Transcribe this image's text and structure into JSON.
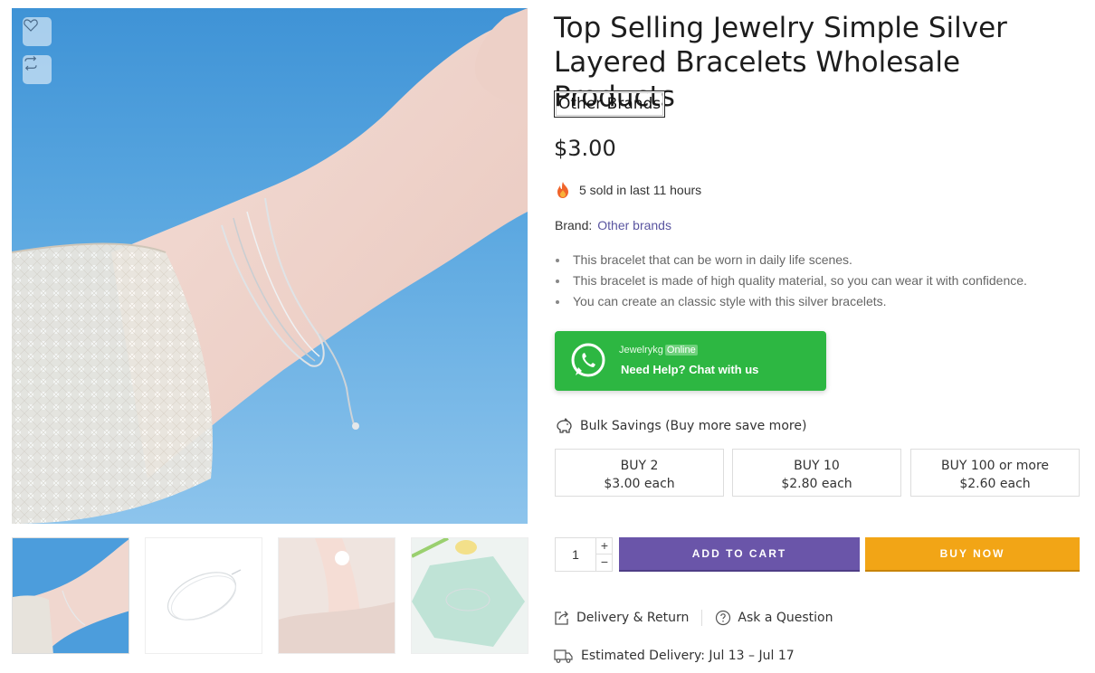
{
  "product": {
    "title": "Top Selling Jewelry Simple Silver Layered Bracelets Wholesale Products",
    "brand_tag": "Other Brands",
    "price": "$3.00",
    "sold_text": "5 sold in last 11 hours",
    "brand_label": "Brand:",
    "brand_value": "Other brands",
    "bullets": [
      "This bracelet that can be worn in daily life scenes.",
      "This bracelet is made of high quality material, so you can wear it with confidence.",
      "You can create an classic style with this silver bracelets."
    ]
  },
  "whatsapp": {
    "name": "Jewelrykg",
    "status": "Online",
    "cta": "Need Help? Chat with us",
    "color": "#2db742"
  },
  "bulk": {
    "heading": "Bulk Savings (Buy more save more)",
    "tiers": [
      {
        "qty": "BUY 2",
        "price": "$3.00 each"
      },
      {
        "qty": "BUY 10",
        "price": "$2.80 each"
      },
      {
        "qty": "BUY 100 or more",
        "price": "$2.60 each"
      }
    ]
  },
  "cart": {
    "quantity": "1",
    "plus": "+",
    "minus": "−",
    "add_to_cart": "ADD TO CART",
    "buy_now": "BUY NOW",
    "add_color": "#6a55a9",
    "buy_color": "#f2a516"
  },
  "links": {
    "delivery_return": "Delivery & Return",
    "ask_question": "Ask a Question",
    "estimated_delivery": "Estimated Delivery: Jul 13 – Jul 17"
  },
  "icons": {
    "wishlist": "heart-icon",
    "compare": "compare-icon",
    "fire": "fire-icon",
    "whatsapp": "whatsapp-icon",
    "bulk": "piggy-bank-icon",
    "delivery_return": "share-box-icon",
    "ask": "question-circle-icon",
    "truck": "truck-icon"
  }
}
